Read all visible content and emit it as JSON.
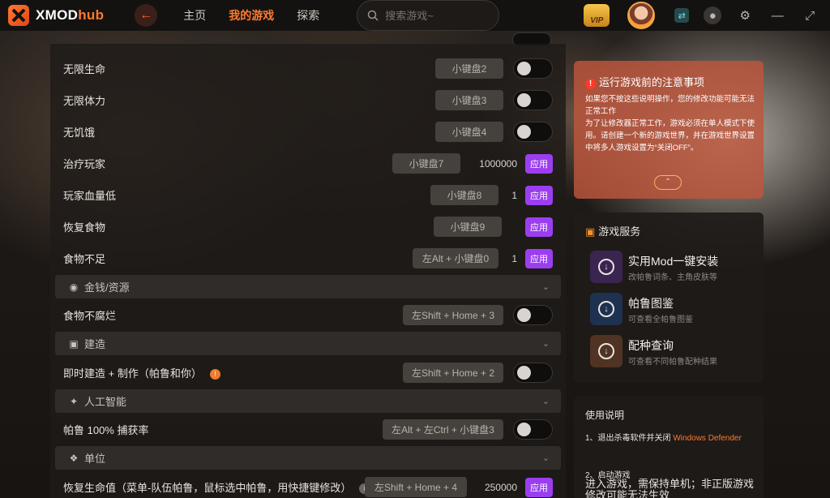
{
  "app": {
    "logo_main": "XMOD",
    "logo_accent": "hub"
  },
  "nav": {
    "home": "主页",
    "my_games": "我的游戏",
    "explore": "探索"
  },
  "search": {
    "placeholder": "搜索游戏~"
  },
  "vip_label": "VIP",
  "rows": [
    {
      "name": "无限生命",
      "key": "小键盘2",
      "control": "toggle"
    },
    {
      "name": "无限体力",
      "key": "小键盘3",
      "control": "toggle"
    },
    {
      "name": "无饥饿",
      "key": "小键盘4",
      "control": "toggle"
    },
    {
      "name": "治疗玩家",
      "key": "小键盘7",
      "value": "1000000",
      "control": "apply"
    },
    {
      "name": "玩家血量低",
      "key": "小键盘8",
      "value": "1",
      "control": "apply"
    },
    {
      "name": "恢复食物",
      "key": "小键盘9",
      "control": "apply"
    },
    {
      "name": "食物不足",
      "key": "左Alt + 小键盘0",
      "value": "1",
      "control": "apply"
    }
  ],
  "sections": {
    "money": "金钱/资源",
    "build": "建造",
    "ai": "人工智能",
    "unit": "单位"
  },
  "rows2": [
    {
      "name": "食物不腐烂",
      "key": "左Shift + Home + 3",
      "control": "toggle"
    },
    {
      "name": "即时建造 + 制作（帕鲁和你）",
      "key": "左Shift + Home + 2",
      "control": "toggle",
      "info": "!"
    },
    {
      "name": "帕鲁 100% 捕获率",
      "key": "左Alt + 左Ctrl + 小键盘3",
      "control": "toggle"
    },
    {
      "name": "恢复生命值（菜单-队伍帕鲁，鼠标选中帕鲁，用快捷键修改）",
      "key": "左Shift + Home + 4",
      "value": "250000",
      "control": "apply",
      "info": "i"
    }
  ],
  "apply_label": "应用",
  "notice": {
    "title": "运行游戏前的注意事项",
    "body": "如果您不按这些说明操作，您的修改功能可能无法正常工作\n为了让修改器正常工作，游戏必须在单人模式下使用。请创建一个新的游戏世界，并在游戏世界设置中将多人游戏设置为“关闭OFF”。"
  },
  "services": {
    "title": "游戏服务",
    "items": [
      {
        "name": "实用Mod一键安装",
        "desc": "改帕鲁词条、主角皮肤等",
        "color": "#3a2450"
      },
      {
        "name": "帕鲁图鉴",
        "desc": "可查看全帕鲁图鉴",
        "color": "#1f3150"
      },
      {
        "name": "配种查询",
        "desc": "可查看不同帕鲁配种结果",
        "color": "#503322"
      }
    ]
  },
  "usage": {
    "title": "使用说明",
    "step1": "1、退出杀毒软件并关闭 ",
    "step1_highlight": "Windows Defender",
    "step2_title": "2、启动游戏",
    "step2_body": "进入游戏，需保持单机；非正版游戏修改可能无法生效"
  },
  "colors": {
    "accent": "#ff7a2e",
    "apply": "#9b3ef0",
    "notice": "#be553c"
  }
}
